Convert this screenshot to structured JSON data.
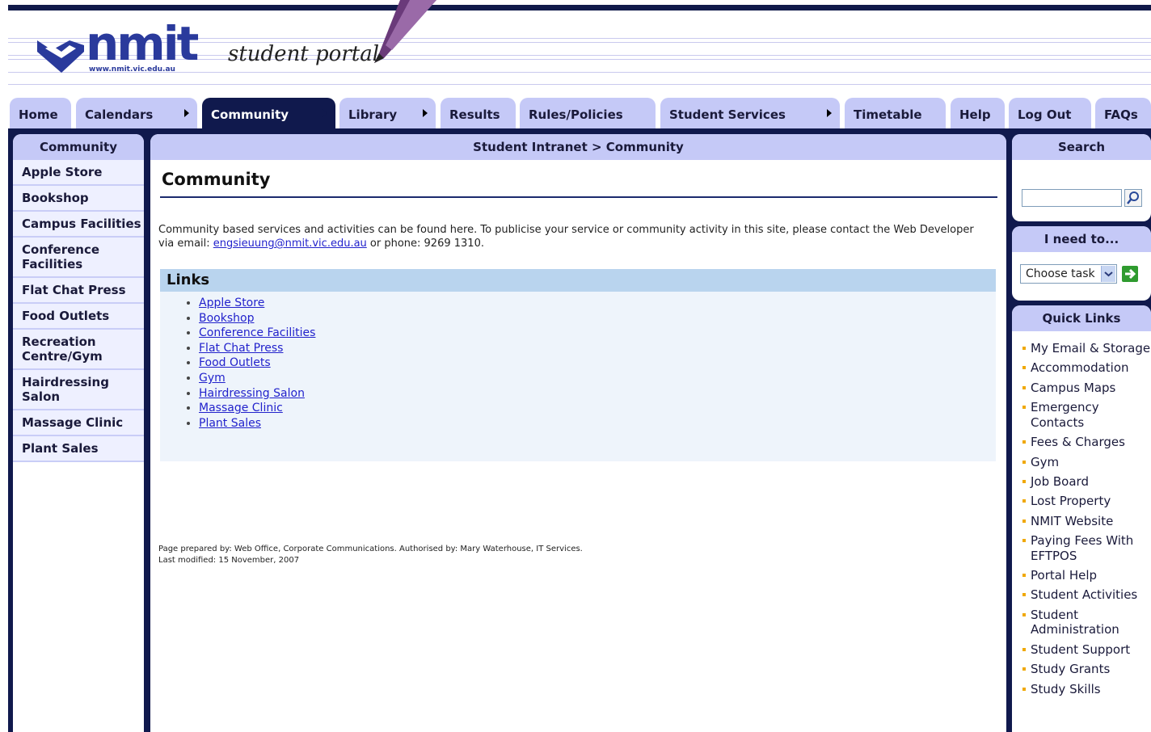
{
  "header": {
    "logo_text": "nmit",
    "logo_url": "www.nmit.vic.edu.au",
    "portal_title": "student portal"
  },
  "nav": {
    "tabs": [
      {
        "label": "Home"
      },
      {
        "label": "Calendars"
      },
      {
        "label": "Community"
      },
      {
        "label": "Library"
      },
      {
        "label": "Results"
      },
      {
        "label": "Rules/Policies"
      },
      {
        "label": "Student Services"
      },
      {
        "label": "Timetable"
      },
      {
        "label": "Help"
      },
      {
        "label": "Log Out"
      },
      {
        "label": "FAQs"
      }
    ],
    "active": "Community"
  },
  "sidebar": {
    "title": "Community",
    "items": [
      {
        "label": "Apple Store"
      },
      {
        "label": "Bookshop"
      },
      {
        "label": "Campus Facilities"
      },
      {
        "label": "Conference Facilities"
      },
      {
        "label": "Flat Chat Press"
      },
      {
        "label": "Food Outlets"
      },
      {
        "label": "Recreation Centre/Gym"
      },
      {
        "label": "Hairdressing Salon"
      },
      {
        "label": "Massage Clinic"
      },
      {
        "label": "Plant Sales"
      }
    ]
  },
  "main": {
    "breadcrumb": "Student Intranet > Community",
    "title": "Community",
    "intro_part1": "Community based services and activities can be found here. To publicise your service or community activity in this site, please contact the Web Developer via email: ",
    "intro_email": "engsieuung@nmit.vic.edu.au",
    "intro_part2": " or phone: 9269 1310.",
    "links_title": "Links",
    "links": [
      {
        "label": "Apple Store"
      },
      {
        "label": "Bookshop"
      },
      {
        "label": "Conference Facilities"
      },
      {
        "label": "Flat Chat Press"
      },
      {
        "label": "Food Outlets"
      },
      {
        "label": "Gym"
      },
      {
        "label": "Hairdressing Salon"
      },
      {
        "label": "Massage Clinic"
      },
      {
        "label": "Plant Sales"
      }
    ],
    "footer_line1": "Page prepared by: Web Office, Corporate Communications. Authorised by: Mary Waterhouse, IT Services.",
    "footer_line2": "Last modified: 15 November, 2007"
  },
  "right": {
    "search_title": "Search",
    "search_value": "",
    "task_title": "I need to...",
    "task_selected": "Choose task",
    "quick_title": "Quick Links",
    "quick_links": [
      {
        "label": "My Email & Storage"
      },
      {
        "label": "Accommodation"
      },
      {
        "label": "Campus Maps"
      },
      {
        "label": "Emergency Contacts"
      },
      {
        "label": "Fees & Charges"
      },
      {
        "label": "Gym"
      },
      {
        "label": "Job Board"
      },
      {
        "label": "Lost Property"
      },
      {
        "label": "NMIT Website"
      },
      {
        "label": "Paying Fees With EFTPOS"
      },
      {
        "label": "Portal Help"
      },
      {
        "label": "Student Activities"
      },
      {
        "label": "Student Administration"
      },
      {
        "label": "Student Support"
      },
      {
        "label": "Study Grants"
      },
      {
        "label": "Study Skills"
      }
    ]
  },
  "colors": {
    "navy": "#10194d",
    "tab": "#c5c9f7",
    "link": "#2222cc",
    "bullet": "#f0a800",
    "go": "#2f9b2f"
  },
  "icons": {
    "search": "magnifier-icon",
    "go": "green-arrow-icon",
    "dropdown": "chevron-down-icon"
  }
}
